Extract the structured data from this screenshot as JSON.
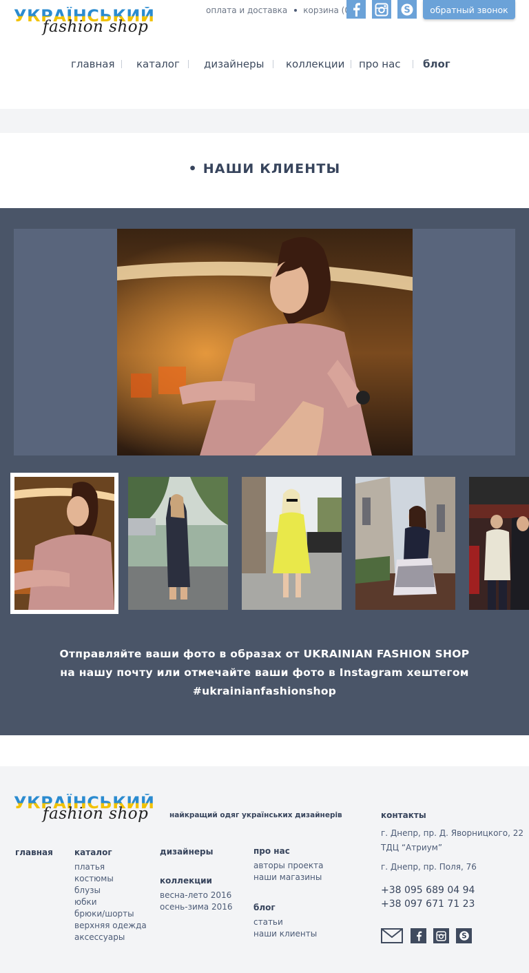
{
  "logo": {
    "line1": "УКРАЇНСЬКИЙ",
    "line2": "fashion shop"
  },
  "topbar": {
    "links": [
      "оплата и доставка",
      "корзина (0)"
    ],
    "social": [
      "facebook-icon",
      "instagram-icon",
      "skype-icon"
    ],
    "callback": "обратный звонок"
  },
  "nav": {
    "items": [
      "главная",
      "каталог",
      "дизайнеры",
      "коллекции",
      "про нас",
      "блог"
    ],
    "active": "блог"
  },
  "section": {
    "title": "• НАШИ КЛИЕНТЫ"
  },
  "gallery": {
    "selected_thumbnail": 1,
    "thumbnail_count": 5,
    "caption": [
      "Отправляйте ваши фото в образах от UKRAINIAN FASHION SHOP",
      "на нашу почту или отмечайте ваши фото в Instagram хештегом",
      "#ukrainianfashionshop"
    ]
  },
  "footer": {
    "tagline": "найкращий одяг українських дизайнерів",
    "col_home": "главная",
    "col_catalog": {
      "title": "каталог",
      "items": [
        "платья",
        "костюмы",
        "блузы",
        "юбки",
        "брюки/шорты",
        "верхняя одежда",
        "аксессуары"
      ]
    },
    "col_designers": "дизайнеры",
    "col_collections": {
      "title": "коллекции",
      "items": [
        "весна-лето 2016",
        "осень-зима 2016"
      ]
    },
    "col_about": {
      "title": "про нас",
      "items": [
        "авторы проекта",
        "наши магазины"
      ]
    },
    "col_blog": {
      "title": "блог",
      "items": [
        "статьи",
        "наши клиенты"
      ]
    },
    "contacts": {
      "title": "контакты",
      "address1_line1": "г. Днепр, пр. Д. Яворницкого, 22",
      "address1_line2": "ТДЦ “Атриум”",
      "address2": "г. Днепр, пр. Поля, 76",
      "phones": [
        "+38 095 689 04 94",
        "+38 097 671 71 23"
      ]
    },
    "social": [
      "mail-icon",
      "facebook-icon",
      "instagram-icon",
      "skype-icon"
    ]
  },
  "colors": {
    "accent": "#6ba2d8",
    "dark": "#4a5568",
    "text": "#3d4a5e",
    "footer_bg": "#f3f4f6"
  }
}
